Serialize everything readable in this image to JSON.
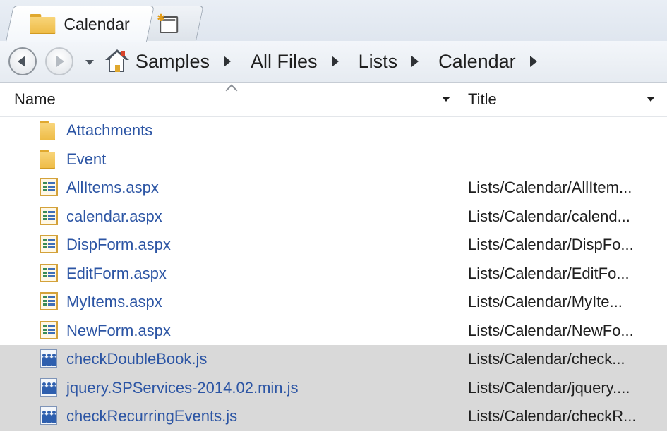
{
  "tabs": [
    {
      "label": "Calendar",
      "icon": "folder-icon",
      "active": true
    },
    {
      "label": "",
      "icon": "new-tab-icon",
      "active": false
    }
  ],
  "breadcrumb": [
    "Samples",
    "All Files",
    "Lists",
    "Calendar"
  ],
  "columns": {
    "name": "Name",
    "title": "Title"
  },
  "rows": [
    {
      "name": "Attachments",
      "title": "",
      "icon": "folder-icon",
      "selected": false
    },
    {
      "name": "Event",
      "title": "",
      "icon": "folder-icon",
      "selected": false
    },
    {
      "name": "AllItems.aspx",
      "title": "Lists/Calendar/AllItem...",
      "icon": "aspx-file-icon",
      "selected": false
    },
    {
      "name": "calendar.aspx",
      "title": "Lists/Calendar/calend...",
      "icon": "aspx-file-icon",
      "selected": false
    },
    {
      "name": "DispForm.aspx",
      "title": "Lists/Calendar/DispFo...",
      "icon": "aspx-file-icon",
      "selected": false
    },
    {
      "name": "EditForm.aspx",
      "title": "Lists/Calendar/EditFo...",
      "icon": "aspx-file-icon",
      "selected": false
    },
    {
      "name": "MyItems.aspx",
      "title": "Lists/Calendar/MyIte...",
      "icon": "aspx-file-icon",
      "selected": false
    },
    {
      "name": "NewForm.aspx",
      "title": "Lists/Calendar/NewFo...",
      "icon": "aspx-file-icon",
      "selected": false
    },
    {
      "name": "checkDoubleBook.js",
      "title": "Lists/Calendar/check...",
      "icon": "js-file-icon",
      "selected": true
    },
    {
      "name": "jquery.SPServices-2014.02.min.js",
      "title": "Lists/Calendar/jquery....",
      "icon": "js-file-icon",
      "selected": true
    },
    {
      "name": "checkRecurringEvents.js",
      "title": "Lists/Calendar/checkR...",
      "icon": "js-file-icon",
      "selected": true
    }
  ],
  "colors": {
    "link": "#2c55a4",
    "selection": "#d9d9d9",
    "folder": "#eebb45"
  }
}
